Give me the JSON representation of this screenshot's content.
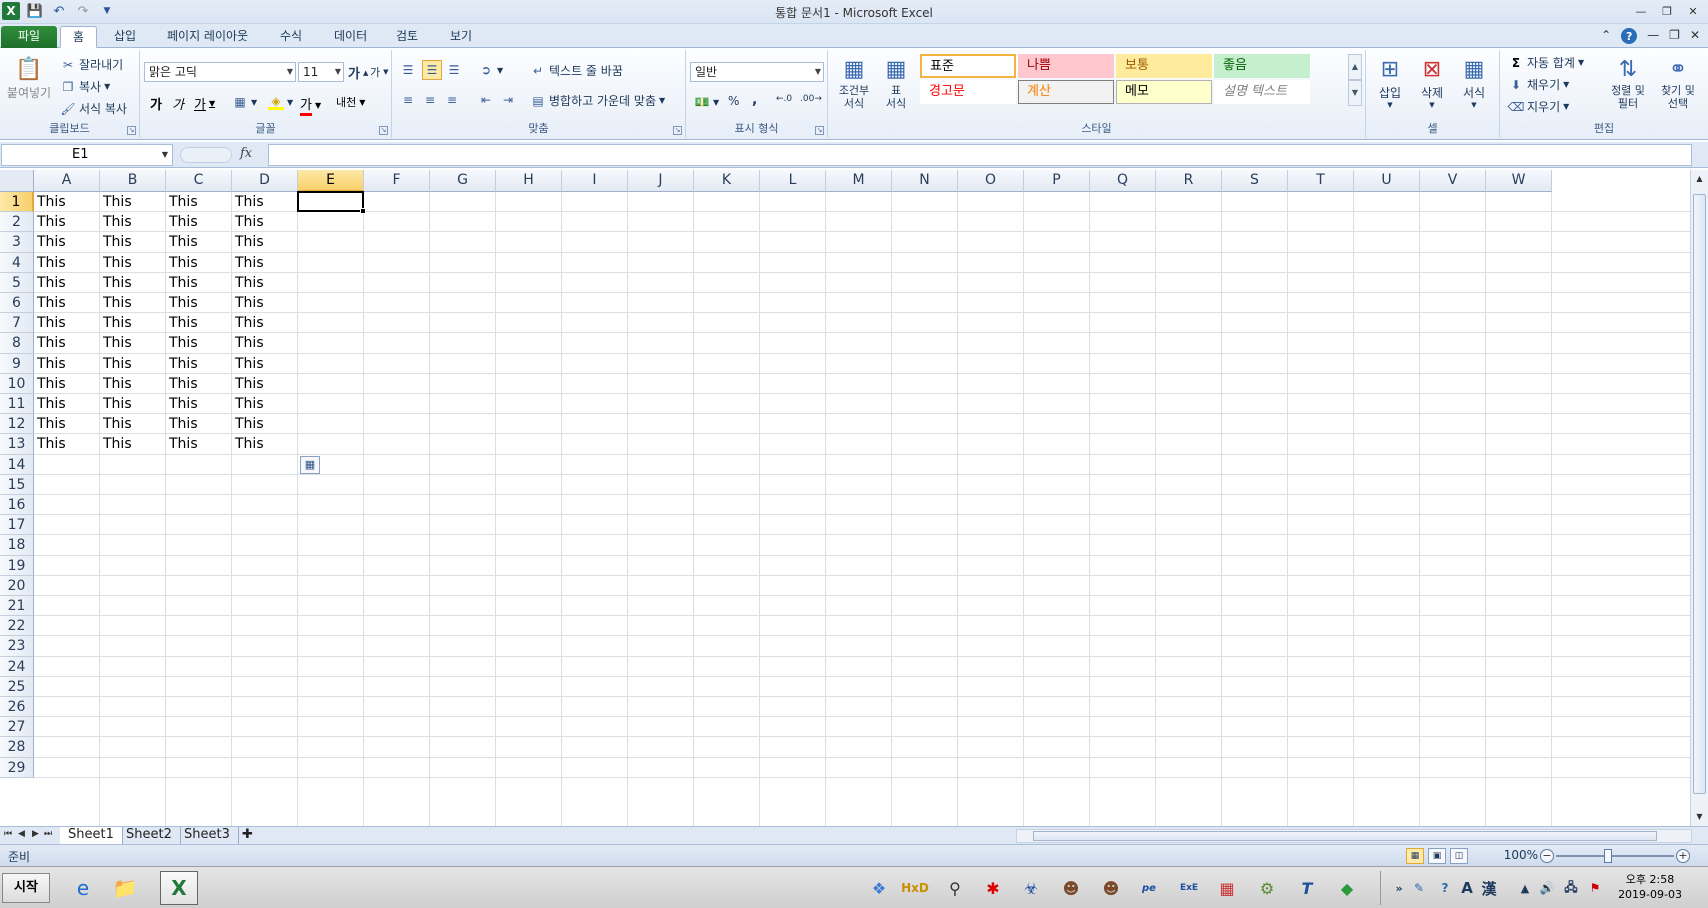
{
  "window": {
    "title": "통합 문서1  -  Microsoft Excel"
  },
  "tabs": [
    {
      "label": "파일"
    },
    {
      "label": "홈"
    },
    {
      "label": "삽입"
    },
    {
      "label": "페이지 레이아웃"
    },
    {
      "label": "수식"
    },
    {
      "label": "데이터"
    },
    {
      "label": "검토"
    },
    {
      "label": "보기"
    }
  ],
  "ribbon": {
    "clipboard": {
      "label": "클립보드",
      "paste": "붙여넣기",
      "cut": "잘라내기",
      "copy": "복사",
      "format_painter": "서식 복사"
    },
    "font": {
      "label": "글꼴",
      "font_name": "맑은 고딕",
      "font_size": "11",
      "grow": "가",
      "shrink": "가",
      "bold": "가",
      "italic": "가",
      "underline": "가",
      "font_color": "가",
      "phonetic": "내천"
    },
    "alignment": {
      "label": "맞춤",
      "wrap_text": "텍스트 줄 바꿈",
      "merge_center": "병합하고 가운데 맞춤"
    },
    "number": {
      "label": "표시 형식",
      "format": "일반",
      "percent": "%",
      "comma": ","
    },
    "styles": {
      "label": "스타일",
      "conditional": "조건부\n서식",
      "conditional_line1": "조건부",
      "conditional_line2": "서식",
      "table_line1": "표",
      "table_line2": "서식",
      "cells": [
        {
          "text": "표준",
          "bg": "#ffffff",
          "color": "#000000",
          "border": "#f1b33e"
        },
        {
          "text": "나쁨",
          "bg": "#ffc7ce",
          "color": "#9c0006",
          "border": "#ffc7ce"
        },
        {
          "text": "보통",
          "bg": "#ffeb9c",
          "color": "#9c5700",
          "border": "#ffeb9c"
        },
        {
          "text": "좋음",
          "bg": "#c6efce",
          "color": "#006100",
          "border": "#c6efce"
        },
        {
          "text": "경고문",
          "bg": "#ffffff",
          "color": "#ff0000",
          "border": "#ffffff"
        },
        {
          "text": "계산",
          "bg": "#f2f2f2",
          "color": "#fa7d00",
          "border": "#7f7f7f"
        },
        {
          "text": "메모",
          "bg": "#ffffcc",
          "color": "#000000",
          "border": "#b2b2b2"
        },
        {
          "text": "설명 텍스트",
          "bg": "#ffffff",
          "color": "#7f7f7f",
          "border": "#ffffff"
        }
      ]
    },
    "cells_group": {
      "label": "셀",
      "insert": "삽입",
      "delete": "삭제",
      "format": "서식"
    },
    "editing": {
      "label": "편집",
      "autosum": "자동 합계",
      "fill": "채우기",
      "clear": "지우기",
      "sort_line1": "정렬 및",
      "sort_line2": "필터",
      "find_line1": "찾기 및",
      "find_line2": "선택"
    }
  },
  "formula_bar": {
    "name_box": "E1",
    "fx": "fx",
    "formula": ""
  },
  "grid": {
    "columns": [
      "A",
      "B",
      "C",
      "D",
      "E",
      "F",
      "G",
      "H",
      "I",
      "J",
      "K",
      "L",
      "M",
      "N",
      "O",
      "P",
      "Q",
      "R",
      "S",
      "T",
      "U",
      "V",
      "W"
    ],
    "rows": [
      "1",
      "2",
      "3",
      "4",
      "5",
      "6",
      "7",
      "8",
      "9",
      "10",
      "11",
      "12",
      "13",
      "14",
      "15",
      "16",
      "17",
      "18",
      "19",
      "20",
      "21",
      "22",
      "23",
      "24",
      "25",
      "26",
      "27",
      "28",
      "29"
    ],
    "selected_column": "E",
    "selected_row": "1",
    "cell_text": "This",
    "filled_rows": 13,
    "filled_columns": 4
  },
  "sheets": [
    {
      "label": "Sheet1",
      "active": true
    },
    {
      "label": "Sheet2",
      "active": false
    },
    {
      "label": "Sheet3",
      "active": false
    }
  ],
  "status": {
    "ready": "준비",
    "zoom": "100%"
  },
  "taskbar": {
    "start": "시작",
    "ime_a": "A",
    "ime_han": "漢",
    "time": "오후 2:58",
    "date": "2019-09-03"
  }
}
